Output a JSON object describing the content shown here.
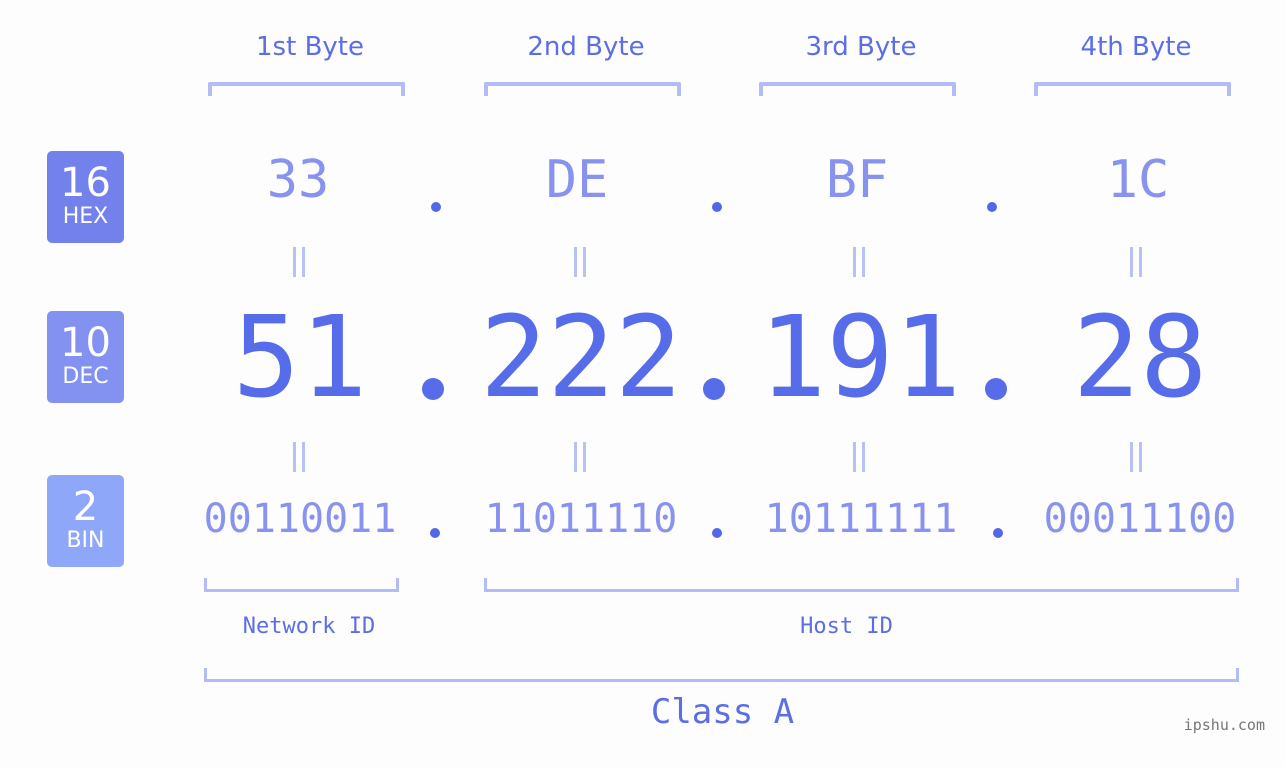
{
  "bytes": [
    {
      "label": "1st Byte",
      "hex": "33",
      "dec": "51",
      "bin": "00110011"
    },
    {
      "label": "2nd Byte",
      "hex": "DE",
      "dec": "222",
      "bin": "11011110"
    },
    {
      "label": "3rd Byte",
      "hex": "BF",
      "dec": "191",
      "bin": "10111111"
    },
    {
      "label": "4th Byte",
      "hex": "1C",
      "dec": "28",
      "bin": "00011100"
    }
  ],
  "badges": {
    "hex": {
      "base": "16",
      "name": "HEX",
      "color": "#7381ec"
    },
    "dec": {
      "base": "10",
      "name": "DEC",
      "color": "#8392f0"
    },
    "bin": {
      "base": "2",
      "name": "BIN",
      "color": "#8fa7f8"
    }
  },
  "separator": ".",
  "equals_symbol": "=",
  "network_label": "Network ID",
  "host_label": "Host ID",
  "class_label": "Class A",
  "watermark": "ipshu.com",
  "colors": {
    "accent": "#566ce9",
    "light_accent": "#8793ee",
    "bracket": "#b3bcf6",
    "background": "#fcfdfc"
  }
}
